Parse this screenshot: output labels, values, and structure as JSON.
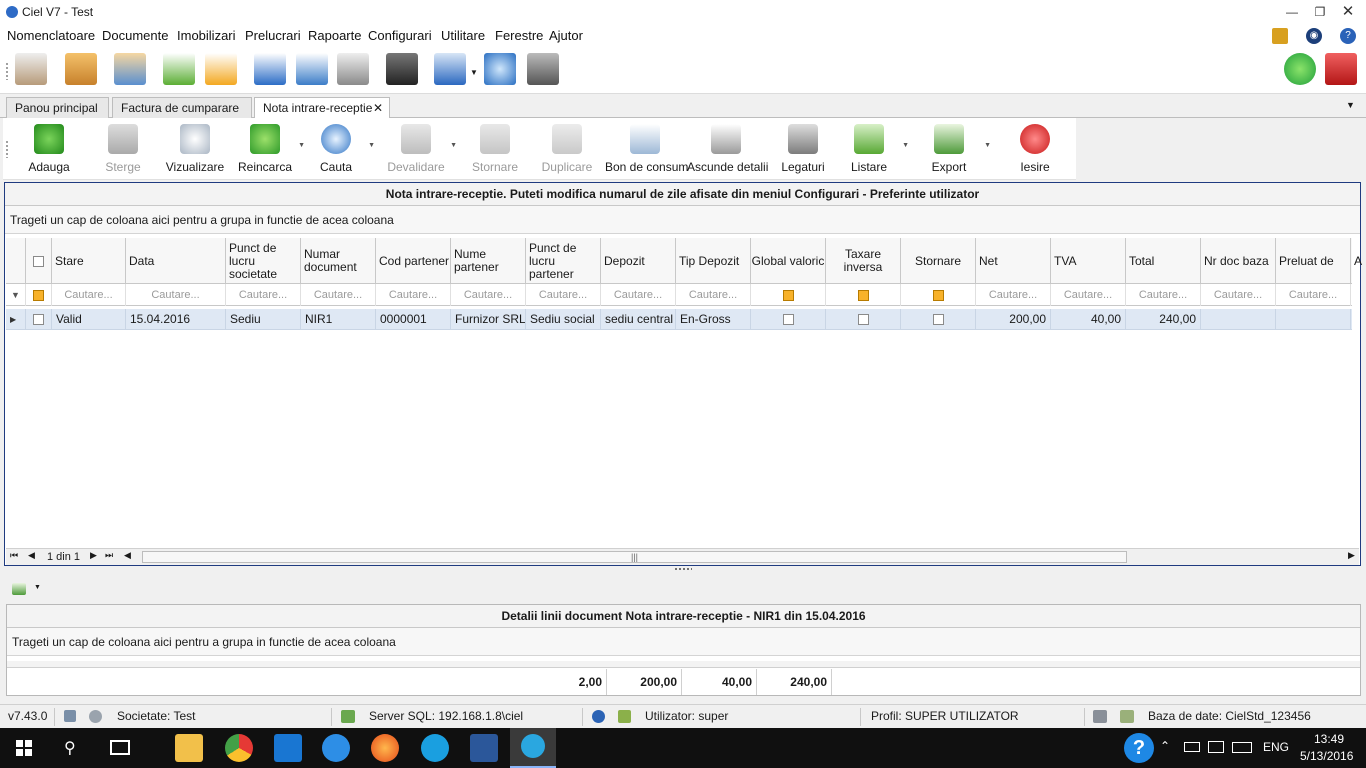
{
  "window": {
    "title": "Ciel V7 - Test"
  },
  "menu": [
    "Nomenclatoare",
    "Documente",
    "Imobilizari",
    "Prelucrari",
    "Rapoarte",
    "Configurari",
    "Utilitare",
    "Ferestre",
    "Ajutor"
  ],
  "tabs": [
    "Panou principal",
    "Factura de cumparare",
    "Nota intrare-receptie"
  ],
  "ribbon": {
    "adauga": "Adauga",
    "sterge": "Sterge",
    "vizualizare": "Vizualizare",
    "reincarca": "Reincarca",
    "cauta": "Cauta",
    "devalidare": "Devalidare",
    "stornare": "Stornare",
    "duplicare": "Duplicare",
    "bon": "Bon de consum",
    "ascunde": "Ascunde detalii",
    "legaturi": "Legaturi",
    "listare": "Listare",
    "export": "Export",
    "iesire": "Iesire"
  },
  "main_grid": {
    "caption": "Nota intrare-receptie. Puteti modifica numarul de zile afisate din meniul Configurari - Preferinte utilizator",
    "group_hint": "Trageti un cap de coloana aici pentru a grupa in functie de acea coloana",
    "columns": {
      "stare": "Stare",
      "data": "Data",
      "punct_lucru_societate": "Punct de lucru societate",
      "numar_document": "Numar document",
      "cod_partener": "Cod partener",
      "nume_partener": "Nume partener",
      "punct_lucru_partener": "Punct de lucru partener",
      "depozit": "Depozit",
      "tip_depozit": "Tip Depozit",
      "global_valoric": "Global valoric",
      "taxare_inversa": "Taxare inversa",
      "stornare": "Stornare",
      "net": "Net",
      "tva": "TVA",
      "total": "Total",
      "nr_doc_baza": "Nr doc baza",
      "preluat_de": "Preluat de",
      "extra": "A"
    },
    "filter_placeholder": "Cautare...",
    "rows": [
      {
        "stare": "Valid",
        "data": "15.04.2016",
        "punct_lucru_societate": "Sediu",
        "numar_document": "NIR1",
        "cod_partener": "0000001",
        "nume_partener": "Furnizor SRL",
        "punct_lucru_partener": "Sediu social",
        "depozit": "sediu central",
        "tip_depozit": "En-Gross",
        "net": "200,00",
        "tva": "40,00",
        "total": "240,00"
      }
    ],
    "pager": "1 din 1"
  },
  "detail_grid": {
    "caption": "Detalii linii document Nota intrare-receptie - NIR1 din 15.04.2016",
    "group_hint": "Trageti un cap de coloana aici pentru a grupa in functie de acea coloana",
    "totals": [
      "2,00",
      "200,00",
      "40,00",
      "240,00"
    ]
  },
  "status": {
    "version": "v7.43.0",
    "societate": "Societate: Test",
    "server": "Server SQL: 192.168.1.8\\ciel",
    "utilizator": "Utilizator: super",
    "profil": "Profil: SUPER UTILIZATOR",
    "baza": "Baza de date: CielStd_123456"
  },
  "taskbar": {
    "lang": "ENG",
    "time": "13:49",
    "date": "5/13/2016"
  },
  "colors": {
    "accent": "#1f3b80",
    "selection": "#dfe8f4",
    "checkbox_orange": "#f8b22a"
  }
}
